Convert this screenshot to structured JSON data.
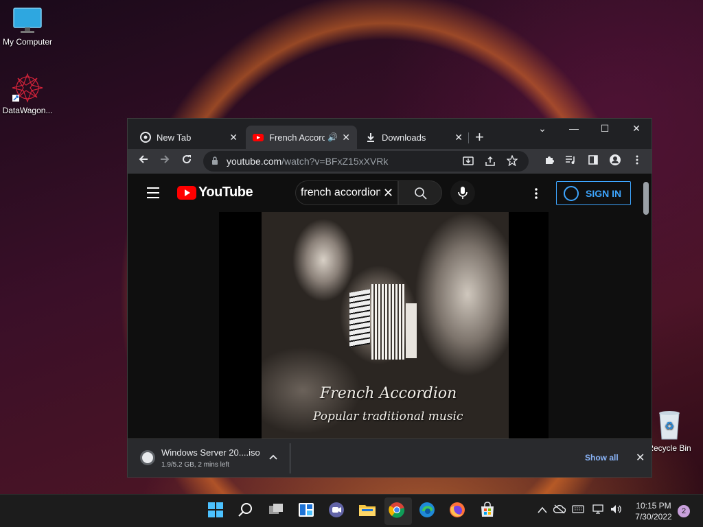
{
  "desktop": {
    "icons": [
      {
        "label": "My Computer",
        "icon": "monitor-icon"
      },
      {
        "label": "DataWagon...",
        "icon": "datawagon-icon"
      },
      {
        "label": "Recycle Bin",
        "icon": "recycle-bin-icon"
      }
    ]
  },
  "browser": {
    "tabs": [
      {
        "label": "New Tab",
        "icon": "chrome-icon"
      },
      {
        "label": "French Accordion",
        "icon": "youtube-icon",
        "audio": "🔊"
      },
      {
        "label": "Downloads",
        "icon": "download-icon"
      }
    ],
    "new_tab": "+",
    "close_glyph": "✕",
    "window_controls": {
      "tab_search": "⌄",
      "minimize": "—",
      "maximize": "☐",
      "close": "✕"
    },
    "address": {
      "host": "youtube.com",
      "path": "/watch?v=BFxZ15xXVRk"
    }
  },
  "youtube": {
    "logo_text": "YouTube",
    "search_value": "french accordion",
    "clear_glyph": "✕",
    "sign_in": "SIGN IN",
    "video": {
      "overlay_title": "French Accordion",
      "overlay_subtitle": "Popular traditional music"
    }
  },
  "downloads_shelf": {
    "file_name": "Windows Server 20....iso",
    "status": "1.9/5.2 GB, 2 mins left",
    "show_all": "Show all",
    "close_glyph": "✕"
  },
  "taskbar": {
    "time": "10:15 PM",
    "date": "7/30/2022",
    "notification_count": "2"
  },
  "colors": {
    "youtube_red": "#ff0000",
    "sign_in_blue": "#3ea6ff",
    "show_all_blue": "#8ab4f8"
  }
}
